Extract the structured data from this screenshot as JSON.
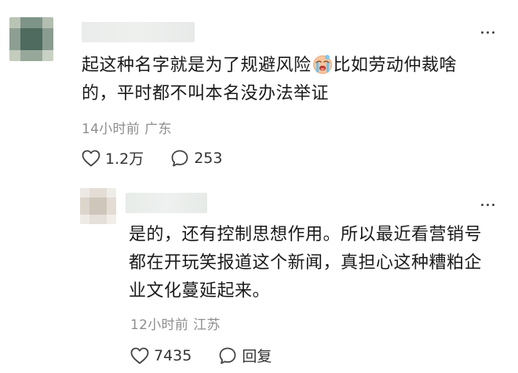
{
  "comments": [
    {
      "text_before_emoji": "起这种名字就是为了规避风险",
      "emoji": "crying-face-emoji",
      "text_after_emoji": "比如劳动仲裁啥的，平时都不叫本名没办法举证",
      "time": "14小时前",
      "location": "广东",
      "like_count": "1.2万",
      "reply_label": "253"
    },
    {
      "text": "是的，还有控制思想作用。所以最近看营销号都在开玩笑报道这个新闻，真担心这种糟粕企业文化蔓延起来。",
      "time": "12小时前",
      "location": "江苏",
      "like_count": "7435",
      "reply_label": "回复"
    }
  ],
  "icons": {
    "like": "heart-outline-icon",
    "reply": "speech-bubble-icon",
    "more": "more-dots-icon"
  },
  "colors": {
    "text": "#1a1a1a",
    "meta": "#8e8e8e",
    "icon": "#444444"
  }
}
